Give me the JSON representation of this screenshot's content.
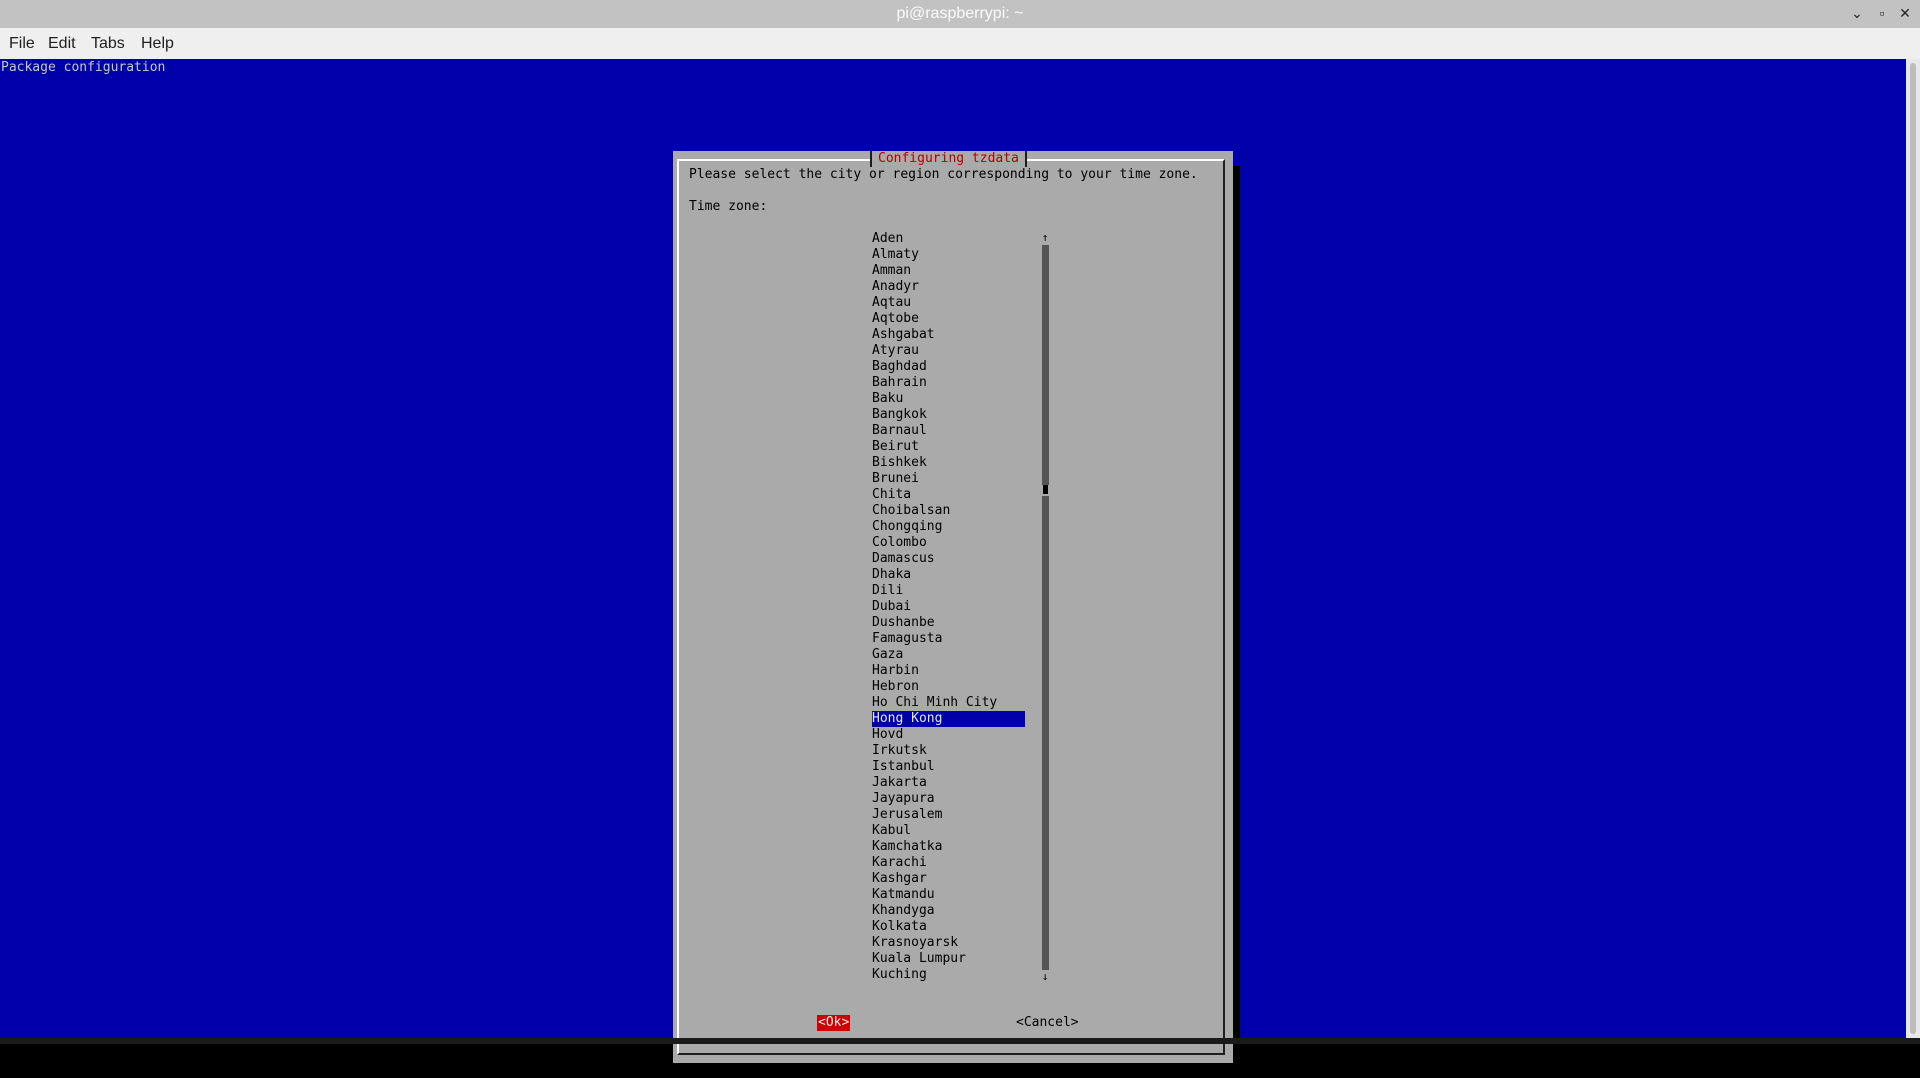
{
  "window": {
    "title": "pi@raspberrypi: ~"
  },
  "menu": [
    "File",
    "Edit",
    "Tabs",
    "Help"
  ],
  "terminal": {
    "header": "Package configuration"
  },
  "dialog": {
    "title": "Configuring tzdata",
    "prompt": "Please select the city or region corresponding to your time zone.",
    "field_label": "Time zone:",
    "options": [
      "Aden",
      "Almaty",
      "Amman",
      "Anadyr",
      "Aqtau",
      "Aqtobe",
      "Ashgabat",
      "Atyrau",
      "Baghdad",
      "Bahrain",
      "Baku",
      "Bangkok",
      "Barnaul",
      "Beirut",
      "Bishkek",
      "Brunei",
      "Chita",
      "Choibalsan",
      "Chongqing",
      "Colombo",
      "Damascus",
      "Dhaka",
      "Dili",
      "Dubai",
      "Dushanbe",
      "Famagusta",
      "Gaza",
      "Harbin",
      "Hebron",
      "Ho Chi Minh City",
      "Hong Kong",
      "Hovd",
      "Irkutsk",
      "Istanbul",
      "Jakarta",
      "Jayapura",
      "Jerusalem",
      "Kabul",
      "Kamchatka",
      "Karachi",
      "Kashgar",
      "Katmandu",
      "Khandyga",
      "Kolkata",
      "Krasnoyarsk",
      "Kuala Lumpur",
      "Kuching"
    ],
    "selected": "Hong Kong",
    "scroll_up": "↑",
    "scroll_down": "↓",
    "ok_label": "<Ok>",
    "cancel_label": "<Cancel>"
  },
  "colors": {
    "terminal_bg": "#0000aa",
    "dialog_bg": "#aaaaaa",
    "accent_red": "#cc0000",
    "title_red": "#b40000"
  }
}
